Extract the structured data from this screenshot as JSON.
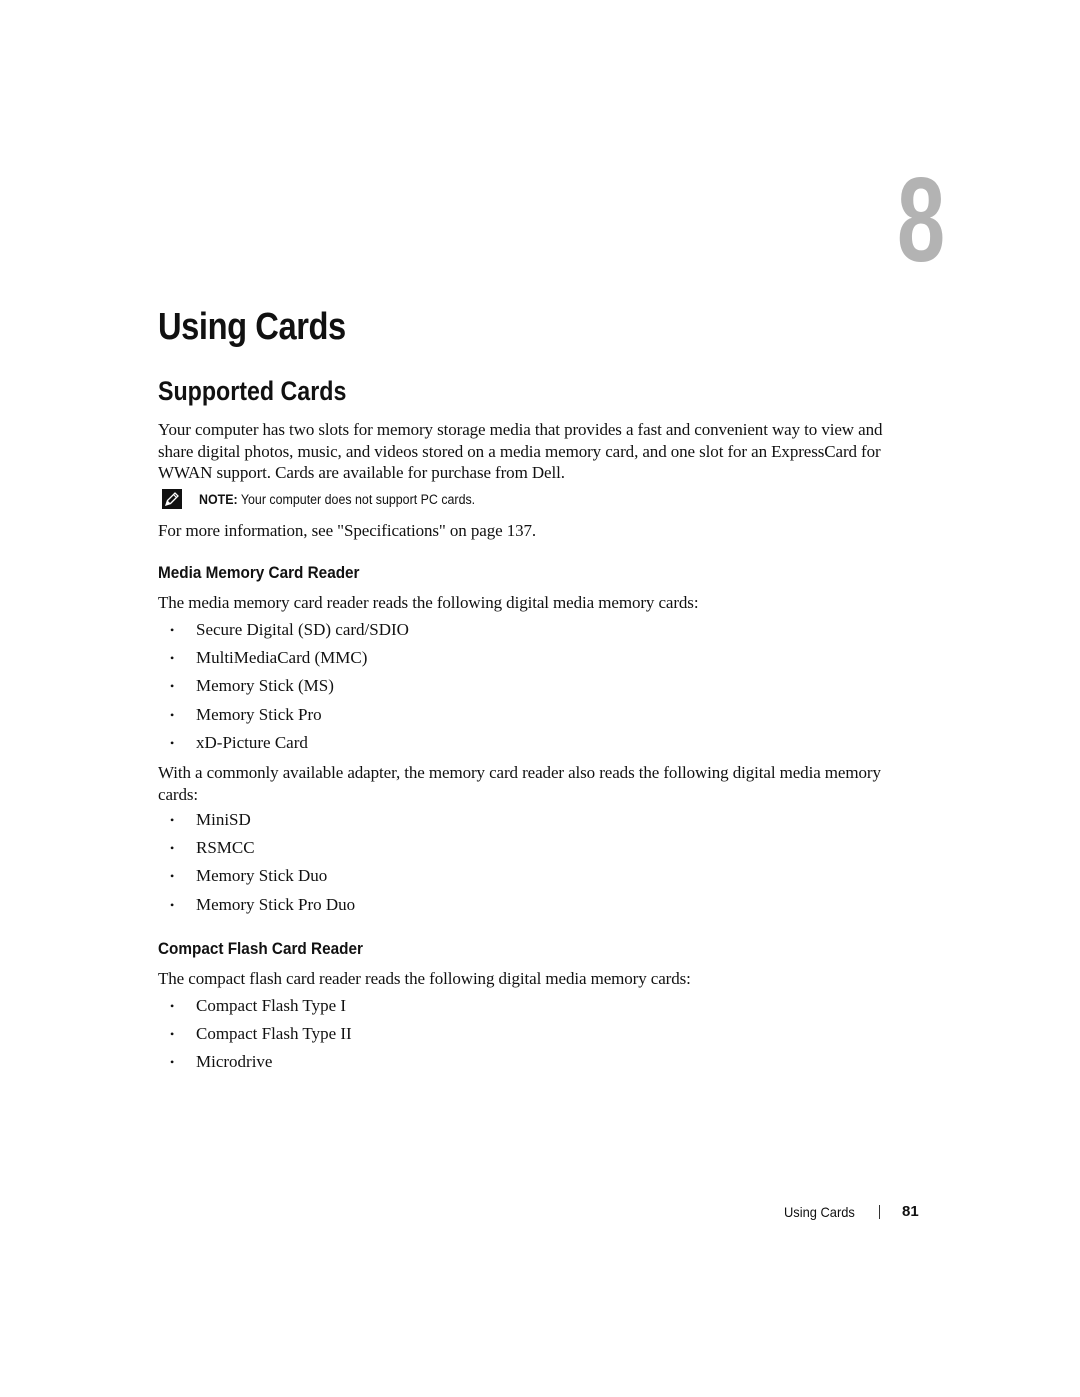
{
  "chapter": {
    "number": "8",
    "title": "Using Cards"
  },
  "section": {
    "title": "Supported Cards",
    "intro": "Your computer has two slots for memory storage media that provides a fast and convenient way to view and share digital photos, music, and videos stored on a media memory card, and one slot for an ExpressCard for WWAN support. Cards are available for purchase from Dell.",
    "note": {
      "icon": "pencil-note-icon",
      "label": "NOTE:",
      "text": " Your computer does not support PC cards."
    },
    "more_info": "For more information, see \"Specifications\" on page 137."
  },
  "media_reader": {
    "heading": "Media Memory Card Reader",
    "intro": "The media memory card reader reads the following digital media memory cards:",
    "cards": [
      "Secure Digital (SD) card/SDIO",
      "MultiMediaCard (MMC)",
      "Memory Stick (MS)",
      "Memory Stick Pro",
      "xD-Picture Card"
    ],
    "adapter_intro": "With a commonly available adapter, the memory card reader also reads the following digital media memory cards:",
    "adapter_cards": [
      "MiniSD",
      "RSMCC",
      "Memory Stick Duo",
      "Memory Stick Pro Duo"
    ]
  },
  "cf_reader": {
    "heading": "Compact Flash Card Reader",
    "intro": "The compact flash card reader reads the following digital media memory cards:",
    "cards": [
      "Compact Flash Type I",
      "Compact Flash Type II",
      "Microdrive"
    ]
  },
  "footer": {
    "title": "Using Cards",
    "page": "81"
  },
  "bullet_glyph": "•"
}
